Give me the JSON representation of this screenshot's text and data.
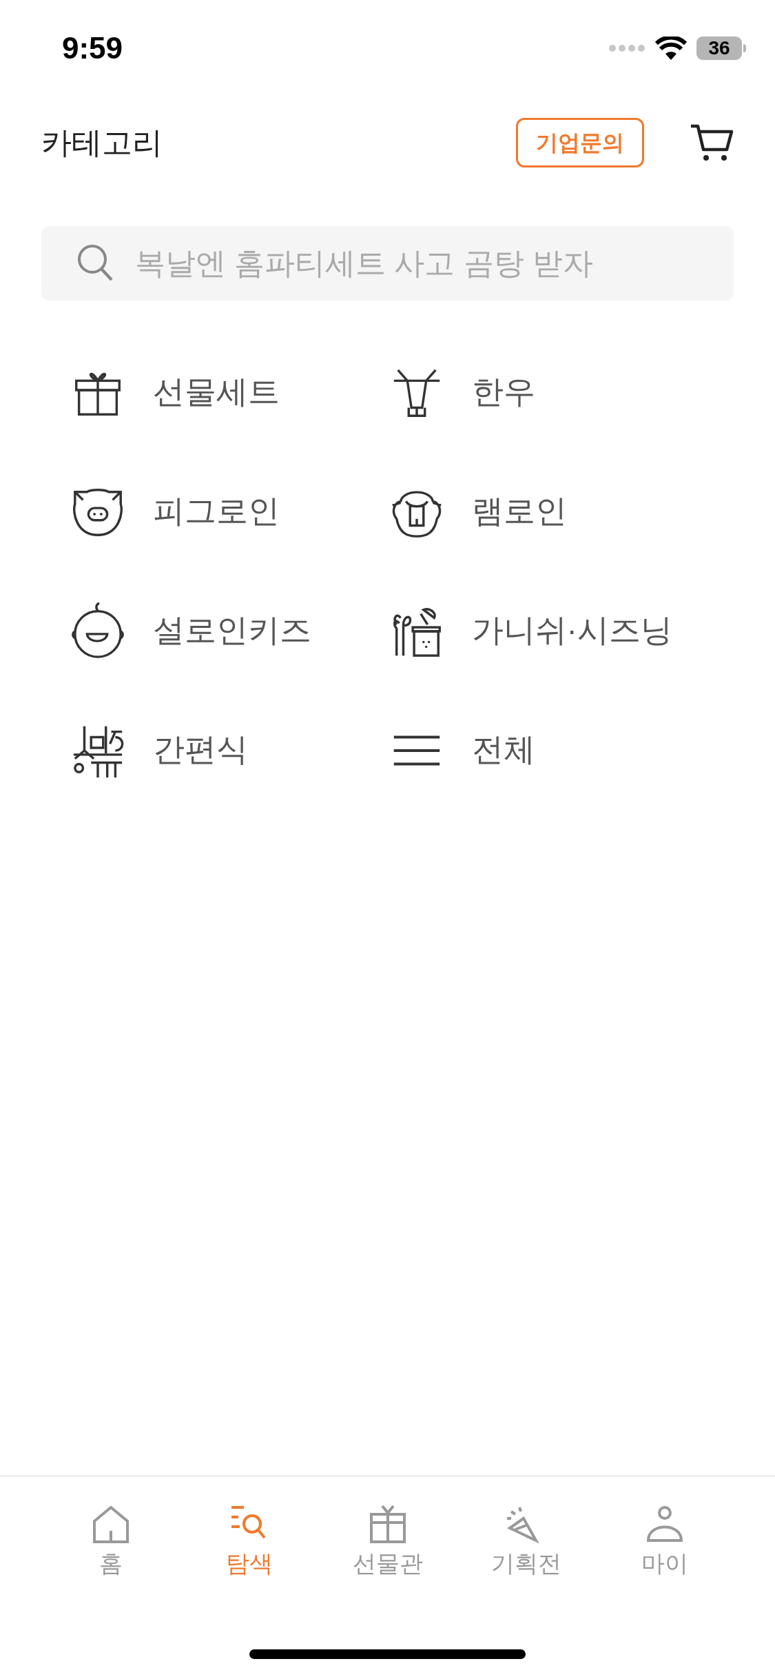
{
  "status_bar": {
    "time": "9:59",
    "battery": "36"
  },
  "header": {
    "title": "카테고리",
    "inquiry_button": "기업문의"
  },
  "search": {
    "placeholder": "복날엔 홈파티세트 사고 곰탕 받자"
  },
  "categories": [
    {
      "label": "선물세트"
    },
    {
      "label": "한우"
    },
    {
      "label": "피그로인"
    },
    {
      "label": "램로인"
    },
    {
      "label": "설로인키즈"
    },
    {
      "label": "가니쉬·시즈닝"
    },
    {
      "label": "간편식"
    },
    {
      "label": "전체"
    }
  ],
  "tab_bar": [
    {
      "label": "홈",
      "selected": false
    },
    {
      "label": "탐색",
      "selected": true
    },
    {
      "label": "선물관",
      "selected": false
    },
    {
      "label": "기획전",
      "selected": false
    },
    {
      "label": "마이",
      "selected": false
    }
  ]
}
